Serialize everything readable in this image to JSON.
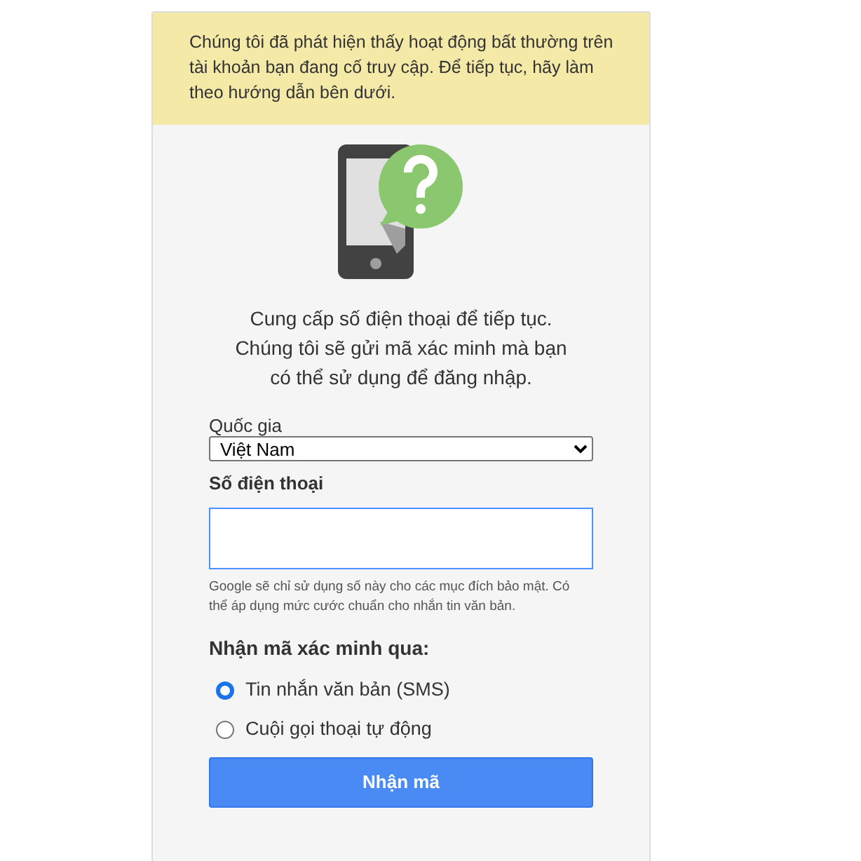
{
  "alert": {
    "text": "Chúng tôi đã phát hiện thấy hoạt động bất thường trên tài khoản bạn đang cố truy cập. Để tiếp tục, hãy làm theo hướng dẫn bên dưới."
  },
  "intro": [
    "Cung cấp số điện thoại để tiếp tục.",
    "Chúng tôi sẽ gửi mã xác minh mà bạn",
    "có thể sử dụng để đăng nhập."
  ],
  "country": {
    "label": "Quốc gia",
    "value": "Việt Nam"
  },
  "phone": {
    "label": "Số điện thoại",
    "hint": "Google sẽ chỉ sử dụng số này cho các mục đích bảo mật. Có thể áp dụng mức cước chuẩn cho nhắn tin văn bản."
  },
  "method": {
    "label": "Nhận mã xác minh qua:",
    "options": [
      {
        "label": "Tin nhắn văn bản (SMS)",
        "selected": true
      },
      {
        "label": "Cuội gọi thoại tự động",
        "selected": false
      }
    ]
  },
  "submit": "Nhận mã"
}
